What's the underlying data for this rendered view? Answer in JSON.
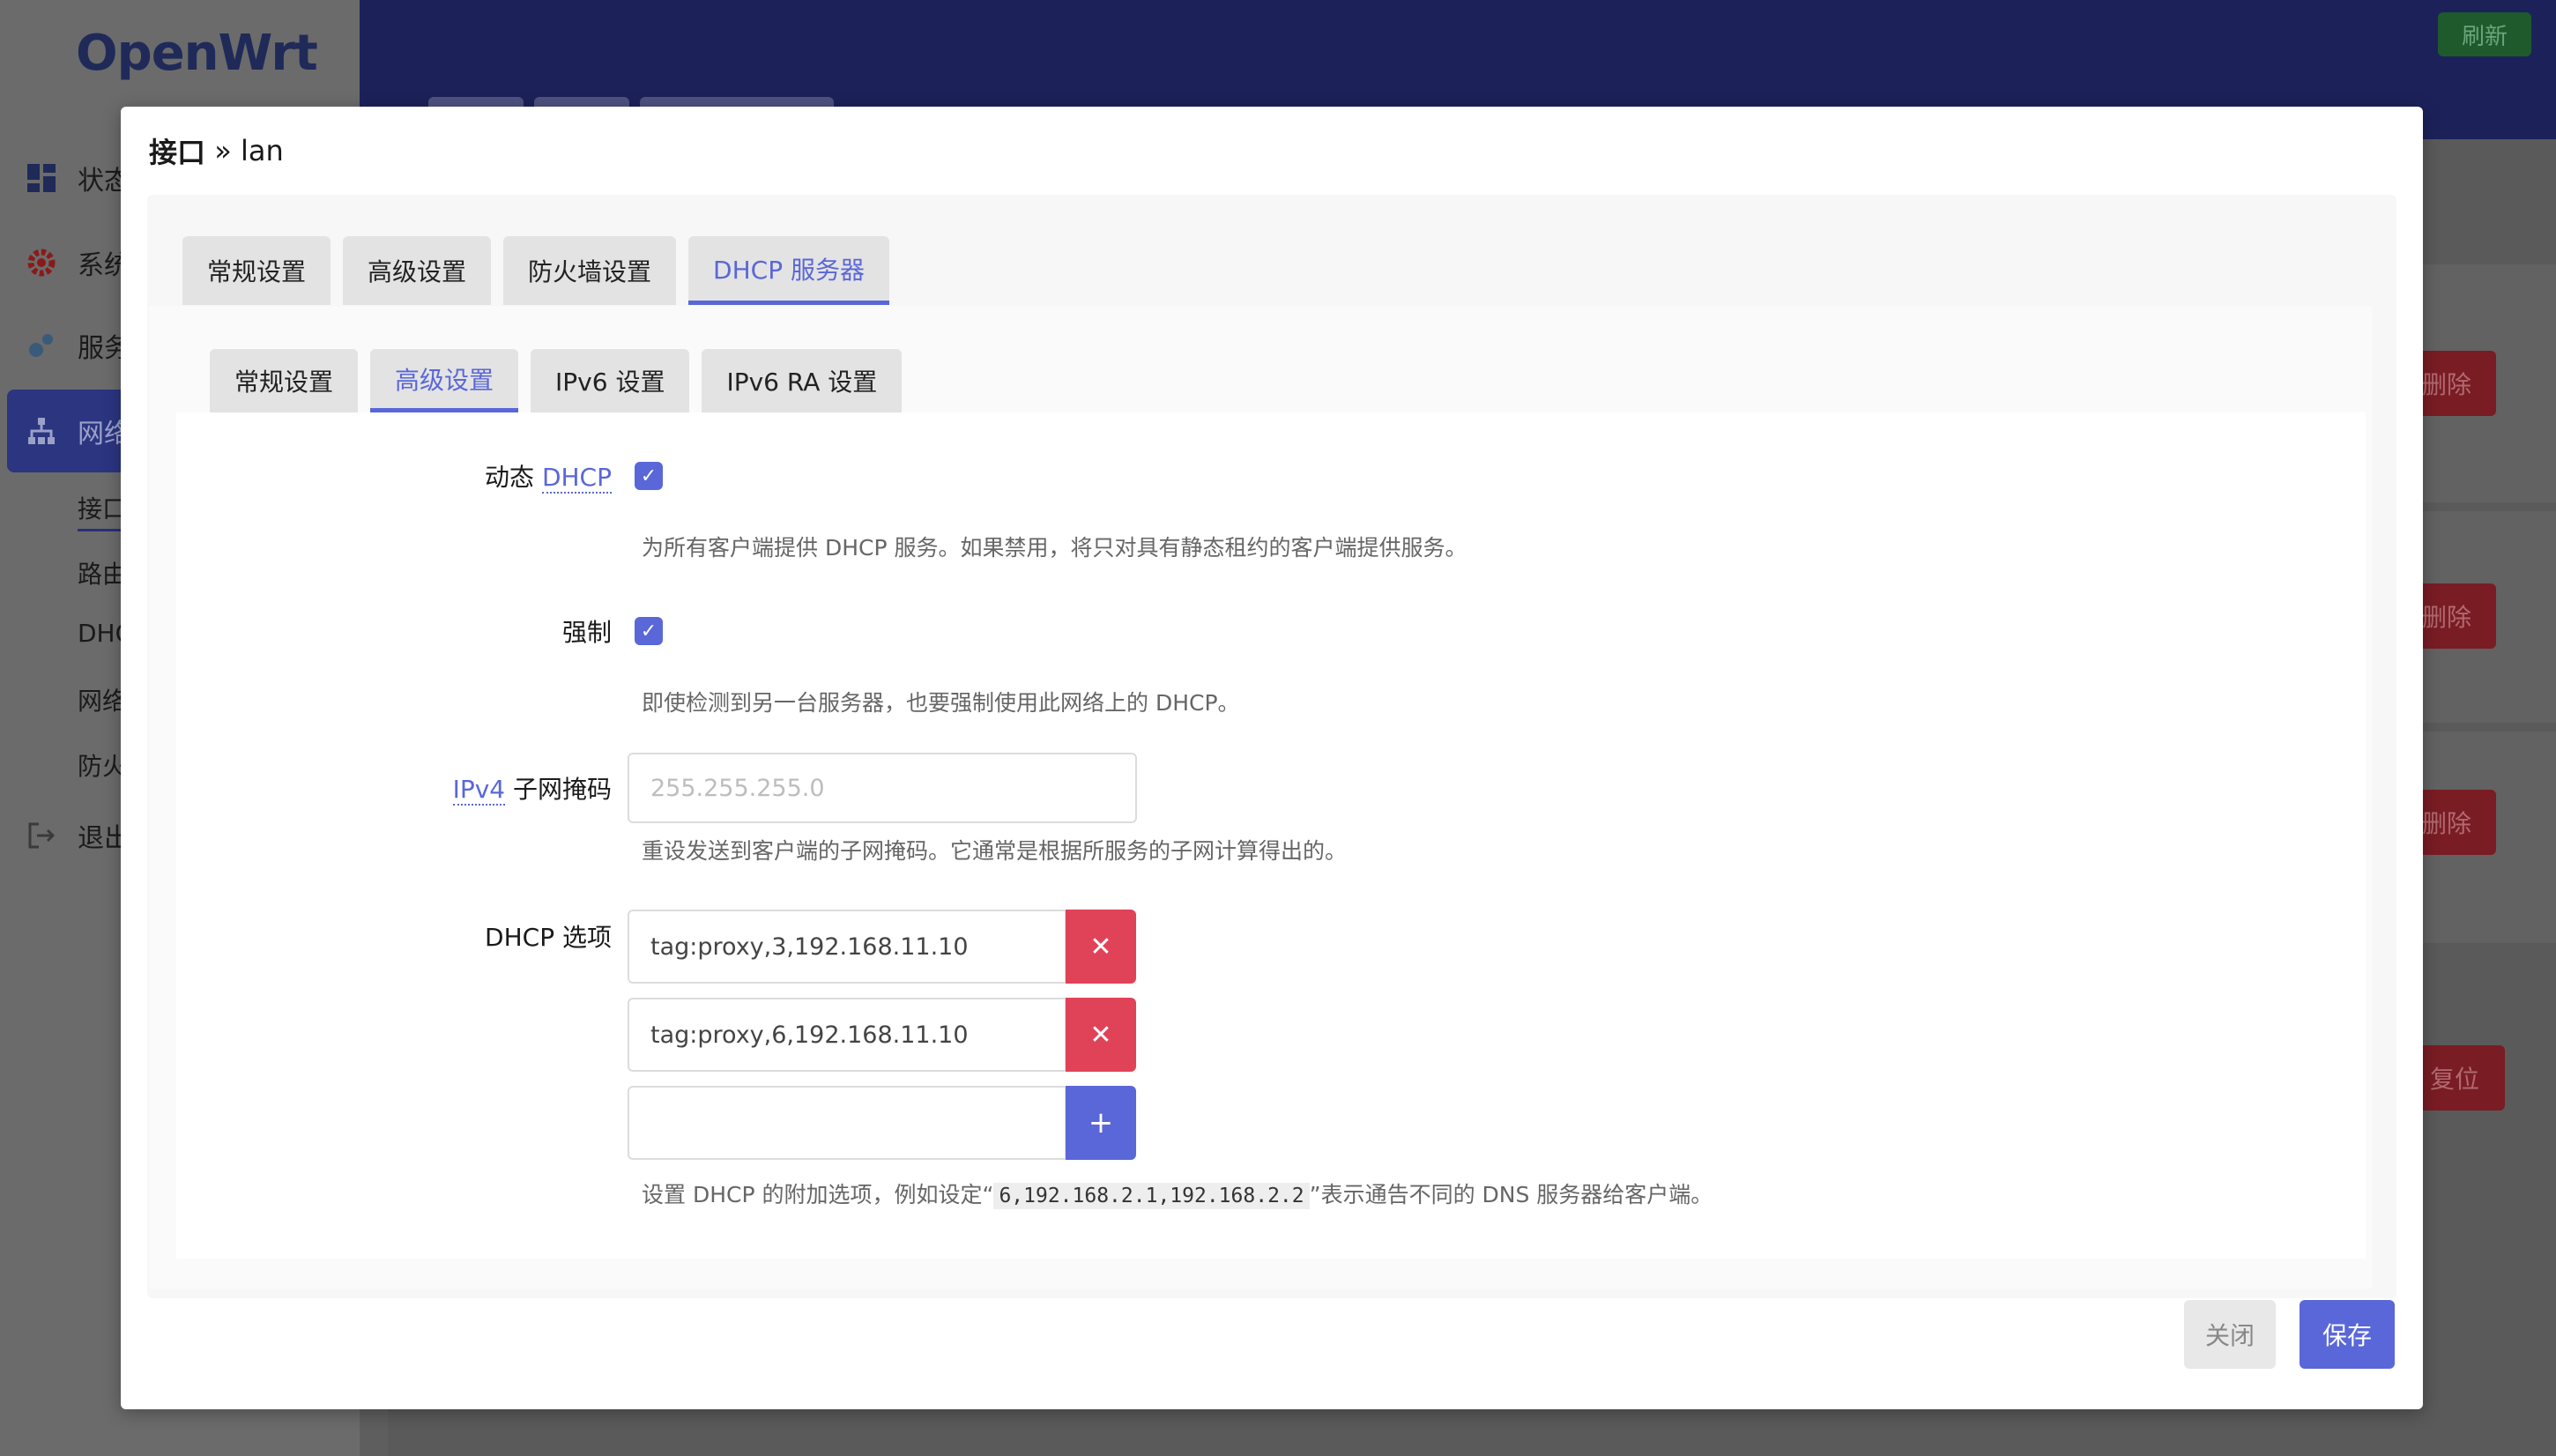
{
  "app": {
    "logo": "OpenWrt",
    "refresh_label": "刷新",
    "sidebar": [
      {
        "label": "状态",
        "icon": "dashboard-icon"
      },
      {
        "label": "系统",
        "icon": "gear-icon"
      },
      {
        "label": "服务",
        "icon": "services-icon"
      },
      {
        "label": "网络",
        "icon": "network-icon"
      },
      {
        "label": "退出",
        "icon": "logout-icon"
      }
    ],
    "subitems": [
      "接口",
      "路由",
      "DHCP",
      "网络",
      "防火"
    ],
    "bg_buttons": {
      "delete": "删除",
      "reset": "复位"
    }
  },
  "modal": {
    "title_prefix": "接口",
    "title_sep": " » ",
    "title_name": "lan",
    "main_tabs": [
      "常规设置",
      "高级设置",
      "防火墙设置",
      "DHCP 服务器"
    ],
    "sub_tabs": [
      "常规设置",
      "高级设置",
      "IPv6 设置",
      "IPv6 RA 设置"
    ],
    "fields": {
      "dynamic_dhcp": {
        "label_prefix": "动态 ",
        "label_abbr": "DHCP",
        "checked": true,
        "description": "为所有客户端提供 DHCP 服务。如果禁用，将只对具有静态租约的客户端提供服务。"
      },
      "force": {
        "label": "强制",
        "checked": true,
        "description": "即使检测到另一台服务器，也要强制使用此网络上的 DHCP。"
      },
      "netmask": {
        "label_abbr": "IPv4",
        "label_suffix": " 子网掩码",
        "placeholder": "255.255.255.0",
        "description": "重设发送到客户端的子网掩码。它通常是根据所服务的子网计算得出的。"
      },
      "dhcp_options": {
        "label": "DHCP 选项",
        "values": [
          "tag:proxy,3,192.168.11.10",
          "tag:proxy,6,192.168.11.10"
        ],
        "new_value": "",
        "desc_before": "设置 DHCP 的附加选项，例如设定“",
        "desc_code": "6,192.168.2.1,192.168.2.2",
        "desc_after": "”表示通告不同的 DNS 服务器给客户端。"
      }
    },
    "close_label": "关闭",
    "save_label": "保存"
  },
  "colors": {
    "accent": "#5a67d8",
    "danger": "#e04358",
    "topbar": "#1c2259"
  }
}
